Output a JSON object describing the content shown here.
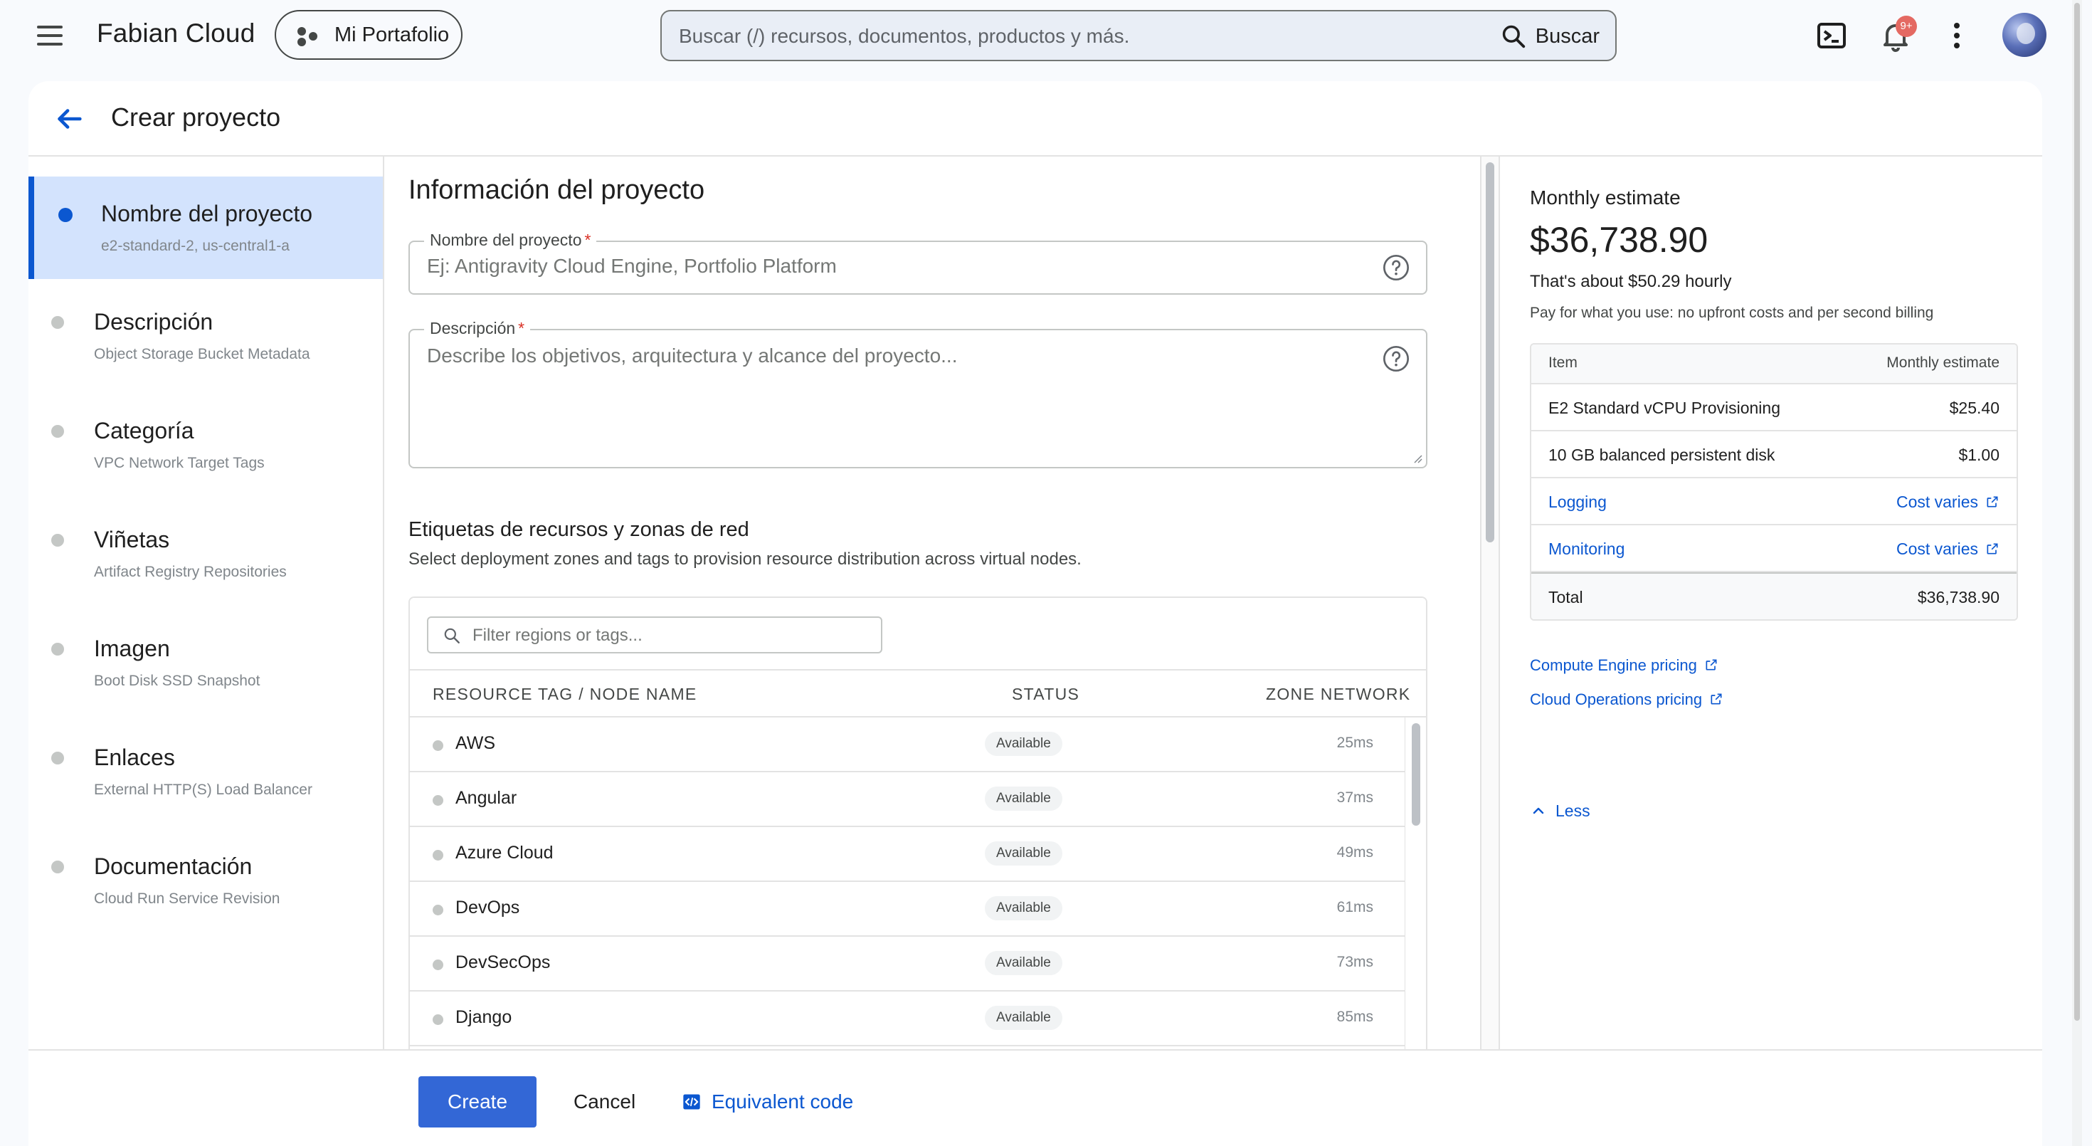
{
  "app": {
    "brand": "Fabian Cloud",
    "portfolio_button": "Mi Portafolio",
    "search": {
      "placeholder": "Buscar (/) recursos, documentos, productos y más.",
      "button_label": "Buscar"
    },
    "notifications_badge": "9+"
  },
  "page": {
    "title": "Crear proyecto"
  },
  "steps": [
    {
      "title": "Nombre del proyecto",
      "subtitle": "e2-standard-2, us-central1-a",
      "active": true
    },
    {
      "title": "Descripción",
      "subtitle": "Object Storage Bucket Metadata",
      "active": false
    },
    {
      "title": "Categoría",
      "subtitle": "VPC Network Target Tags",
      "active": false
    },
    {
      "title": "Viñetas",
      "subtitle": "Artifact Registry Repositories",
      "active": false
    },
    {
      "title": "Imagen",
      "subtitle": "Boot Disk SSD Snapshot",
      "active": false
    },
    {
      "title": "Enlaces",
      "subtitle": "External HTTP(S) Load Balancer",
      "active": false
    },
    {
      "title": "Documentación",
      "subtitle": "Cloud Run Service Revision",
      "active": false
    }
  ],
  "form": {
    "section_title": "Información del proyecto",
    "name_field": {
      "label": "Nombre del proyecto",
      "required_mark": "*",
      "placeholder": "Ej: Antigravity Cloud Engine, Portfolio Platform",
      "value": ""
    },
    "description_field": {
      "label": "Descripción",
      "required_mark": "*",
      "placeholder": "Describe los objetivos, arquitectura y alcance del proyecto...",
      "value": ""
    },
    "tags": {
      "title": "Etiquetas de recursos y zonas de red",
      "subtitle": "Select deployment zones and tags to provision resource distribution across virtual nodes.",
      "filter_placeholder": "Filter regions or tags...",
      "columns": [
        "RESOURCE TAG / NODE NAME",
        "STATUS",
        "ZONE NETWORK"
      ],
      "rows": [
        {
          "name": "AWS",
          "status": "Available",
          "zone": "25ms"
        },
        {
          "name": "Angular",
          "status": "Available",
          "zone": "37ms"
        },
        {
          "name": "Azure Cloud",
          "status": "Available",
          "zone": "49ms"
        },
        {
          "name": "DevOps",
          "status": "Available",
          "zone": "61ms"
        },
        {
          "name": "DevSecOps",
          "status": "Available",
          "zone": "73ms"
        },
        {
          "name": "Django",
          "status": "Available",
          "zone": "85ms"
        }
      ]
    }
  },
  "estimate": {
    "label": "Monthly estimate",
    "amount": "$36,738.90",
    "hourly": "That's about $50.29 hourly",
    "note": "Pay for what you use: no upfront costs and per second billing",
    "table": {
      "header_item": "Item",
      "header_value": "Monthly estimate",
      "rows": [
        {
          "item": "E2 Standard vCPU Provisioning",
          "value": "$25.40"
        },
        {
          "item": "10 GB balanced persistent disk",
          "value": "$1.00"
        },
        {
          "item": "Logging",
          "value": "Cost varies"
        },
        {
          "item": "Monitoring",
          "value": "Cost varies"
        }
      ],
      "total_label": "Total",
      "total_value": "$36,738.90"
    },
    "links": [
      {
        "label": "Compute Engine pricing"
      },
      {
        "label": "Cloud Operations pricing"
      }
    ],
    "less_label": "Less"
  },
  "footer": {
    "create": "Create",
    "cancel": "Cancel",
    "equivalent_code": "Equivalent code"
  },
  "colors": {
    "primary": "#0b57d0",
    "create_button": "#3367d6",
    "active_step_bg": "#d3e3fd",
    "badge": "#e46962"
  }
}
